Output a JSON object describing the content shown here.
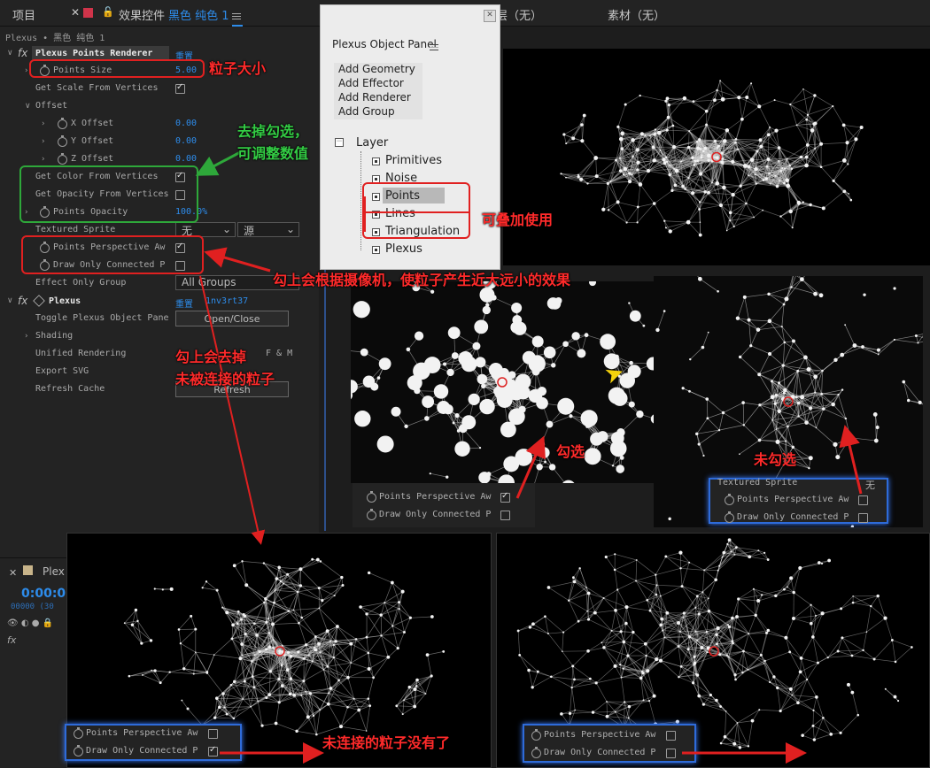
{
  "top_bar": {
    "project_tab": "项目",
    "effects_tab": "效果控件",
    "layer_name": "黑色 纯色 1",
    "layer_info": "层（无）",
    "footage_info": "素材（无）"
  },
  "effects_panel": {
    "breadcrumb": "Plexus • 黑色 纯色 1",
    "renderer_title": "Plexus Points Renderer",
    "reset_label": "重置",
    "points_size_label": "Points Size",
    "points_size_value": "5.00",
    "scale_from_vertices_label": "Get Scale From Vertices",
    "offset_label": "Offset",
    "x_offset_label": "X Offset",
    "x_offset_value": "0.00",
    "y_offset_label": "Y Offset",
    "y_offset_value": "0.00",
    "z_offset_label": "Z Offset",
    "z_offset_value": "0.00",
    "color_from_vertices_label": "Get Color From Vertices",
    "opacity_from_vertices_label": "Get Opacity From Vertices",
    "points_opacity_label": "Points Opacity",
    "points_opacity_value": "100.0%",
    "textured_sprite_label": "Textured Sprite",
    "textured_sprite_value": "无",
    "source_value": "源",
    "perspective_label": "Points Perspective Aw",
    "draw_connected_label": "Draw Only Connected P",
    "effect_only_group_label": "Effect Only Group",
    "effect_only_group_value": "All Groups",
    "plexus_title": "Plexus",
    "plexus_reset": "重置",
    "plexus_id": "1nv3rt37",
    "toggle_panel_label": "Toggle Plexus Object Pane",
    "toggle_panel_button": "Open/Close",
    "shading_label": "Shading",
    "unified_rendering_label": "Unified Rendering",
    "unified_rendering_value": "F & M",
    "export_svg_label": "Export SVG",
    "refresh_cache_label": "Refresh Cache",
    "refresh_button": "Refresh"
  },
  "timeline": {
    "tab": "Plex",
    "timecode": "0:00:0",
    "frames": "00000 (30"
  },
  "plexus_panel": {
    "title": "Plexus Object Panel",
    "menu": [
      "Add Geometry",
      "Add Effector",
      "Add Renderer",
      "Add Group"
    ],
    "tree_root": "Layer",
    "tree_items": [
      "Primitives",
      "Noise",
      "Points",
      "Lines",
      "Triangulation",
      "Plexus"
    ]
  },
  "annotations": {
    "particle_size": "粒子大小",
    "uncheck_line1": "去掉勾选，",
    "uncheck_line2": "可调整数值",
    "stackable": "可叠加使用",
    "perspective_effect": "勾上会根据摄像机，使粒子产生近大远小的效果",
    "remove_line1": "勾上会去掉",
    "remove_line2": "未被连接的粒子",
    "checked": "勾选",
    "unchecked": "未勾选",
    "no_unconnected": "未连接的粒子没有了"
  },
  "mini_panels": {
    "perspective_label": "Points Perspective Aw",
    "draw_connected_label": "Draw Only Connected P",
    "textured_sprite_label": "Textured Sprite",
    "textured_sprite_value": "无"
  },
  "colors": {
    "annotation_red": "#ff2a2a",
    "annotation_green": "#33cc44",
    "accent_blue": "#2d8ceb"
  }
}
